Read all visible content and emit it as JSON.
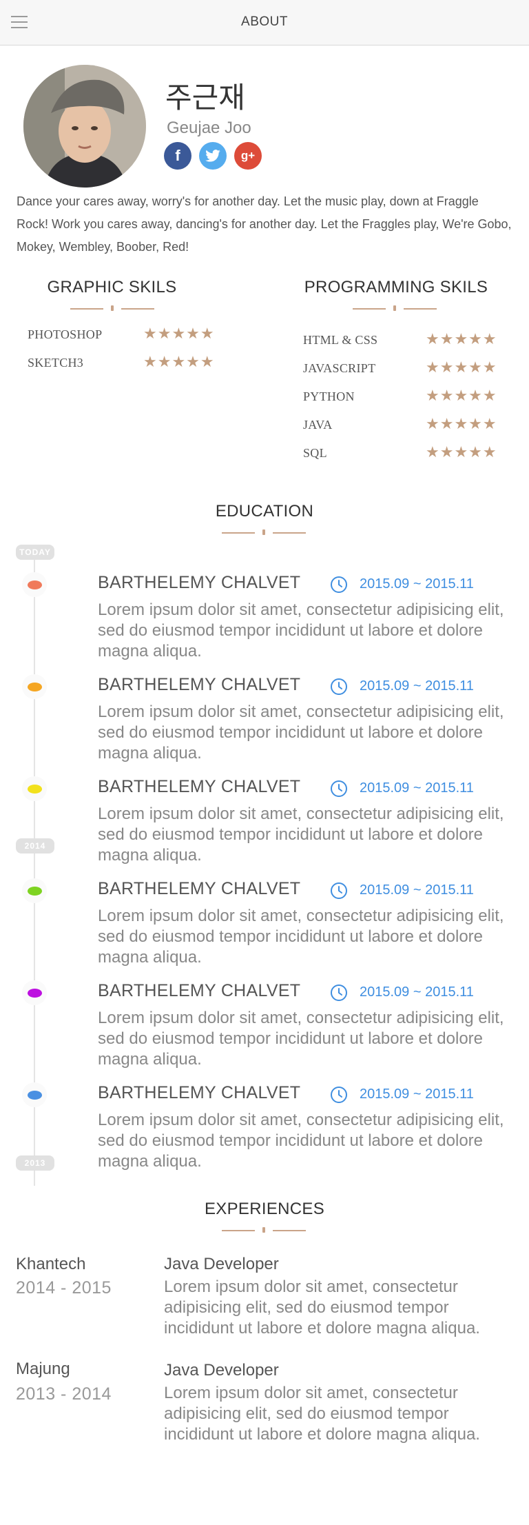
{
  "header": {
    "title": "ABOUT"
  },
  "profile": {
    "name_ko": "주근재",
    "name_en": "Geujae Joo",
    "socials": {
      "facebook": "f",
      "twitter": "t",
      "google": "g+"
    },
    "bio": "Dance your cares away, worry's for another day. Let the music play, down at Fraggle Rock! Work you cares away, dancing's for another day. Let the Fraggles play, We're Gobo, Mokey, Wembley, Boober, Red!"
  },
  "skills": {
    "graphic": {
      "title": "GRAPHIC SKILS",
      "items": [
        {
          "name": "PHOTOSHOP",
          "stars": "★★★★★",
          "rating": 5
        },
        {
          "name": "SKETCH3",
          "stars": "★★★★★",
          "rating": 5
        }
      ]
    },
    "programming": {
      "title": "PROGRAMMING SKILS",
      "items": [
        {
          "name": "HTML & CSS",
          "stars": "★★★★★",
          "rating": 5
        },
        {
          "name": "JAVASCRIPT",
          "stars": "★★★★★",
          "rating": 5
        },
        {
          "name": "PYTHON",
          "stars": "★★★★★",
          "rating": 5
        },
        {
          "name": "JAVA",
          "stars": "★★★★★",
          "rating": 5
        },
        {
          "name": "SQL",
          "stars": "★★★★★",
          "rating": 5
        }
      ]
    }
  },
  "education": {
    "title": "EDUCATION",
    "badges": [
      "TODAY",
      "2014",
      "2013"
    ],
    "items": [
      {
        "title": "BARTHELEMY CHALVET",
        "date": "2015.09 ~ 2015.11",
        "color": "#f07a5b",
        "desc": "Lorem ipsum dolor sit amet, consectetur adipisicing elit, sed do eiusmod tempor incididunt ut labore et dolore magna aliqua."
      },
      {
        "title": "BARTHELEMY CHALVET",
        "date": "2015.09 ~ 2015.11",
        "color": "#f5a623",
        "desc": "Lorem ipsum dolor sit amet, consectetur adipisicing elit, sed do eiusmod tempor incididunt ut labore et dolore magna aliqua."
      },
      {
        "title": "BARTHELEMY CHALVET",
        "date": "2015.09 ~ 2015.11",
        "color": "#f2e11c",
        "desc": "Lorem ipsum dolor sit amet, consectetur adipisicing elit, sed do eiusmod tempor incididunt ut labore et dolore magna aliqua."
      },
      {
        "title": "BARTHELEMY CHALVET",
        "date": "2015.09 ~ 2015.11",
        "color": "#7ed321",
        "desc": "Lorem ipsum dolor sit amet, consectetur adipisicing elit, sed do eiusmod tempor incididunt ut labore et dolore magna aliqua."
      },
      {
        "title": "BARTHELEMY CHALVET",
        "date": "2015.09 ~ 2015.11",
        "color": "#bd10e0",
        "desc": "Lorem ipsum dolor sit amet, consectetur adipisicing elit, sed do eiusmod tempor incididunt ut labore et dolore magna aliqua."
      },
      {
        "title": "BARTHELEMY CHALVET",
        "date": "2015.09 ~ 2015.11",
        "color": "#4a90e2",
        "desc": "Lorem ipsum dolor sit amet, consectetur adipisicing elit, sed do eiusmod tempor incididunt ut labore et dolore magna aliqua."
      }
    ]
  },
  "experiences": {
    "title": "EXPERIENCES",
    "items": [
      {
        "company": "Khantech",
        "years": "2014 - 2015",
        "role": "Java Developer",
        "desc": "Lorem ipsum dolor sit amet, consectetur adipisicing elit, sed do eiusmod tempor incididunt ut labore et dolore magna aliqua."
      },
      {
        "company": "Majung",
        "years": "2013 - 2014",
        "role": "Java Developer",
        "desc": "Lorem ipsum dolor sit amet, consectetur adipisicing elit, sed do eiusmod tempor incididunt ut labore et dolore magna aliqua."
      }
    ]
  },
  "colors": {
    "accent": "#c9a489",
    "date_blue": "#3f8ee0",
    "star": "#c39e7f"
  }
}
